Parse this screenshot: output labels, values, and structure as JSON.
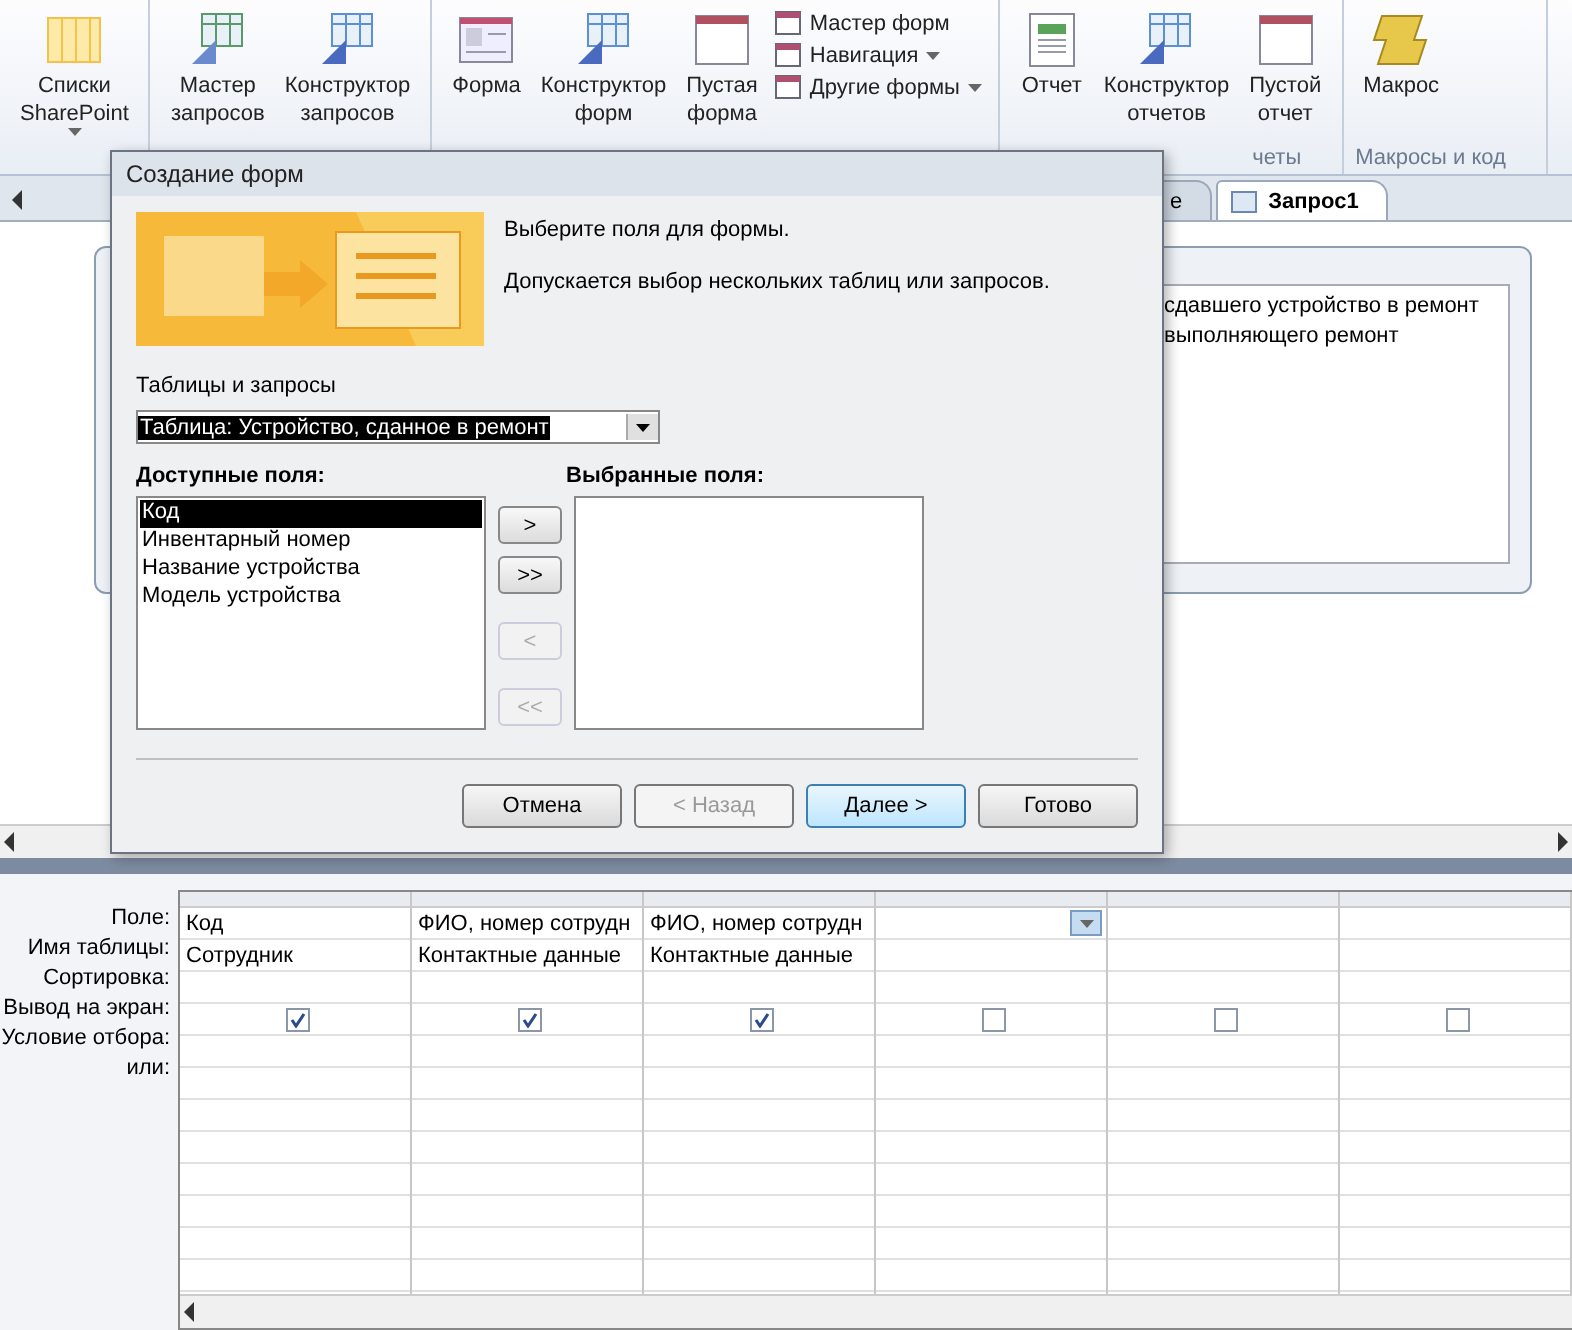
{
  "ribbon": {
    "groups": [
      {
        "big": [
          {
            "label": "Списки\nSharePoint",
            "kind": "list",
            "dropdown": true
          }
        ]
      },
      {
        "big": [
          {
            "label": "Мастер\nзапросов",
            "kind": "wizard"
          },
          {
            "label": "Конструктор\nзапросов",
            "kind": "design"
          }
        ]
      },
      {
        "big": [
          {
            "label": "Форма",
            "kind": "form"
          },
          {
            "label": "Конструктор\nформ",
            "kind": "design"
          },
          {
            "label": "Пустая\nформа",
            "kind": "blank"
          }
        ],
        "small": [
          {
            "label": "Мастер форм"
          },
          {
            "label": "Навигация",
            "dropdown": true
          },
          {
            "label": "Другие формы",
            "dropdown": true
          }
        ]
      },
      {
        "label": "четы",
        "big": [
          {
            "label": "Отчет",
            "kind": "report"
          },
          {
            "label": "Конструктор\nотчетов",
            "kind": "design"
          },
          {
            "label": "Пустой\nотчет",
            "kind": "blank"
          }
        ]
      },
      {
        "label": "Макросы и код",
        "big": [
          {
            "label": "Макрос",
            "kind": "macro"
          }
        ]
      }
    ]
  },
  "tabs": [
    {
      "label": "е",
      "selected": false
    },
    {
      "label": "Запрос1",
      "selected": true
    }
  ],
  "table_box": {
    "fields": [
      "сдавшего устройство в ремонт",
      "выполняющего ремонт"
    ]
  },
  "dialog": {
    "title": "Создание форм",
    "intro": "Выберите поля для формы.",
    "hint": "Допускается выбор нескольких таблиц или запросов.",
    "source_label": "Таблицы и запросы",
    "source_value": "Таблица: Устройство, сданное в ремонт",
    "available_label": "Доступные поля:",
    "selected_label": "Выбранные поля:",
    "available": [
      {
        "label": "Код",
        "selected": true
      },
      {
        "label": "Инвентарный номер",
        "selected": false
      },
      {
        "label": "Название устройства",
        "selected": false
      },
      {
        "label": "Модель устройства",
        "selected": false
      }
    ],
    "move_buttons": [
      {
        "label": ">",
        "disabled": false
      },
      {
        "label": ">>",
        "disabled": false
      },
      {
        "label": "<",
        "disabled": true
      },
      {
        "label": "<<",
        "disabled": true
      }
    ],
    "buttons": [
      {
        "label": "Отмена",
        "disabled": false,
        "default": false
      },
      {
        "label": "< Назад",
        "disabled": true,
        "default": false
      },
      {
        "label": "Далее >",
        "disabled": false,
        "default": true
      },
      {
        "label": "Готово",
        "disabled": false,
        "default": false
      }
    ]
  },
  "grid": {
    "row_labels": [
      "Поле:",
      "Имя таблицы:",
      "Сортировка:",
      "Вывод на экран:",
      "Условие отбора:",
      "или:"
    ],
    "columns": [
      {
        "field": "Код",
        "table": "Сотрудник",
        "show": true,
        "active": false
      },
      {
        "field": "ФИО, номер сотрудн",
        "table": "Контактные данные",
        "show": true,
        "active": false
      },
      {
        "field": "ФИО, номер сотрудн",
        "table": "Контактные данные",
        "show": true,
        "active": false
      },
      {
        "show": false,
        "active": true
      },
      {
        "show": false,
        "active": false
      },
      {
        "show": false,
        "active": false
      }
    ]
  }
}
